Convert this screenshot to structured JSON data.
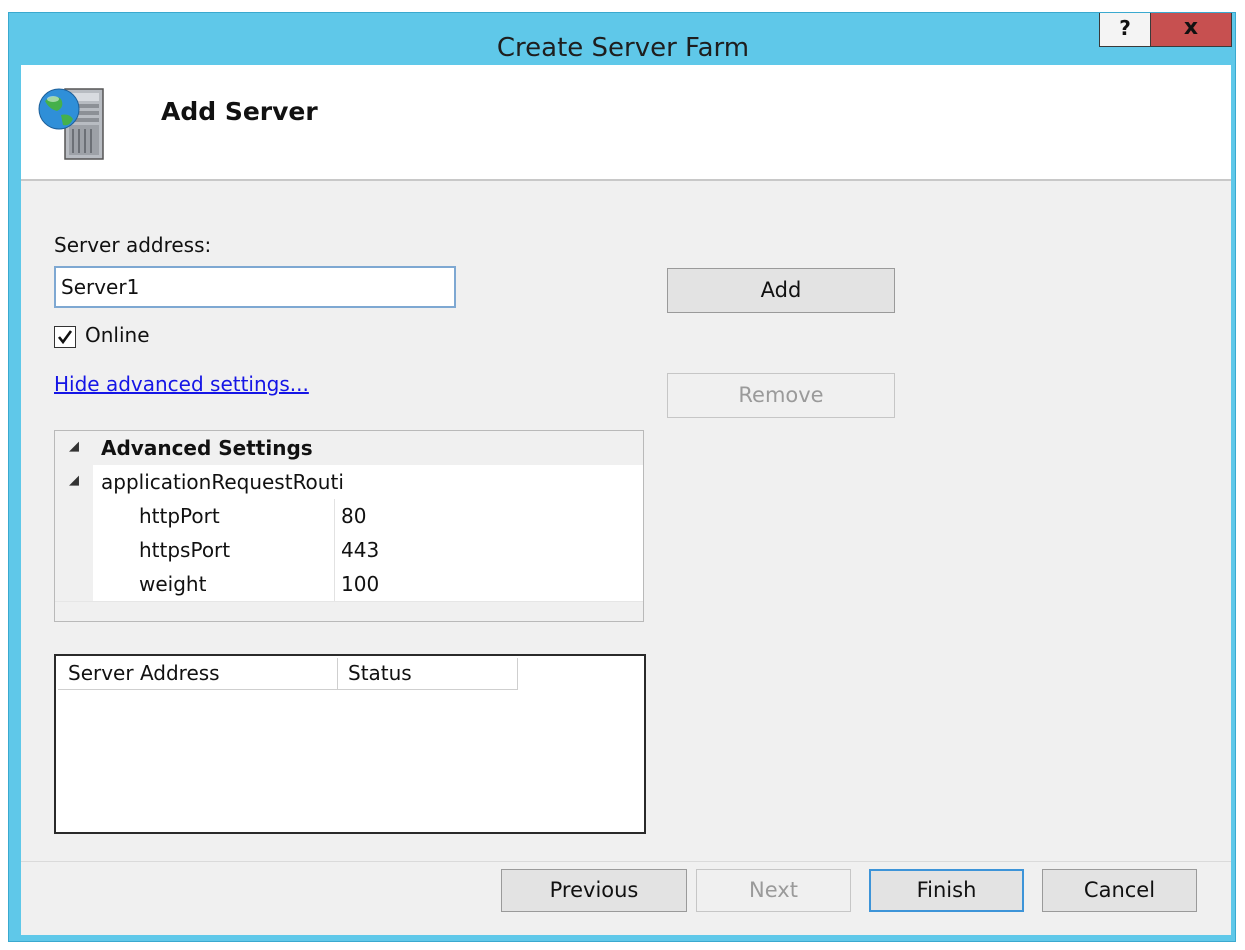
{
  "window": {
    "title": "Create Server Farm",
    "help_button": "?",
    "close_button": "x"
  },
  "header": {
    "title": "Add Server",
    "icon": "server-globe-icon"
  },
  "form": {
    "server_address_label": "Server address:",
    "server_address_value": "Server1",
    "online_label": "Online",
    "online_checked": true,
    "toggle_link": "Hide advanced settings...",
    "add_button": "Add",
    "remove_button": "Remove"
  },
  "advanced": {
    "section_title": "Advanced Settings",
    "group_name": "applicationRequestRouti",
    "rows": [
      {
        "name": "httpPort",
        "value": "80"
      },
      {
        "name": "httpsPort",
        "value": "443"
      },
      {
        "name": "weight",
        "value": "100"
      }
    ]
  },
  "server_list": {
    "columns": [
      "Server Address",
      "Status"
    ],
    "rows": []
  },
  "footer": {
    "previous": "Previous",
    "next": "Next",
    "finish": "Finish",
    "cancel": "Cancel"
  },
  "colors": {
    "title_bar": "#5fc8e9",
    "close_button": "#c75050",
    "link": "#1515e6",
    "focus_border": "#3d94d8"
  }
}
